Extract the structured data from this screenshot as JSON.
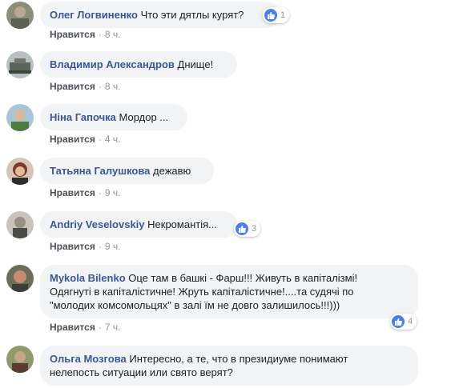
{
  "like_label": "Нравится",
  "dot": "·",
  "comments": [
    {
      "author": "Олег Логвиненко",
      "text": "Что эти дятлы курят?",
      "time": "8 ч.",
      "reactions": "1",
      "avatar_color": "#8a8f7a"
    },
    {
      "author": "Владимир Александров",
      "text": "Днище!",
      "time": "8 ч.",
      "reactions": "",
      "avatar_color": "#6f7670"
    },
    {
      "author": "Ніна Гапочка",
      "text": "Мордор ...",
      "time": "4 ч.",
      "reactions": "",
      "avatar_color": "#c9a88e"
    },
    {
      "author": "Татьяна Галушкова",
      "text": "дежавю",
      "time": "9 ч.",
      "reactions": "",
      "avatar_color": "#7a3b2a"
    },
    {
      "author": "Andriy Veselovskiy",
      "text": "Некромантія...",
      "time": "9 ч.",
      "reactions": "3",
      "avatar_color": "#7b776f"
    },
    {
      "author": "Mykola Bilenko",
      "text_lines": [
        "Оце там в башкі - Фарш!!! Живуть в капіталізмі!",
        "Одягнуті в капіталістичне! Жруть капіталістичне!....та судячі по",
        "\"молодих комсомольцях\" в залі їм не довго залишилось!!!)))"
      ],
      "time": "7 ч.",
      "reactions": "4",
      "avatar_color": "#9b5a4a"
    },
    {
      "author": "Ольга Мозгова",
      "text_lines": [
        "Интересно, а те, что в президиуме понимают",
        "нелепость ситуации или свято верят?"
      ],
      "time": "",
      "reactions": "",
      "avatar_color": "#6e7a55"
    }
  ]
}
